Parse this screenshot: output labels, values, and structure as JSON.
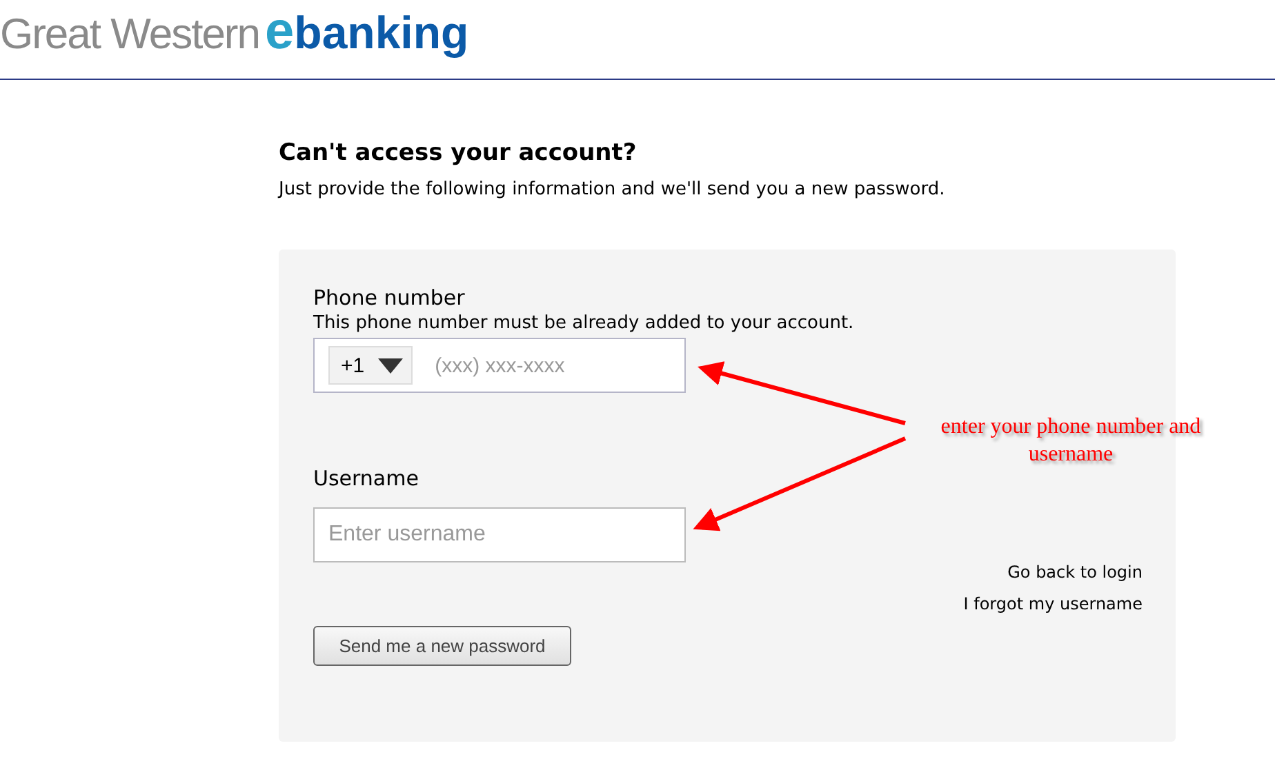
{
  "logo": {
    "brand": "Great Western",
    "mark": "e",
    "product": "banking"
  },
  "heading": "Can't access your account?",
  "intro": "Just provide the following information and we'll send you a new password.",
  "phone": {
    "label": "Phone number",
    "hint": "This phone number must be already added to your account.",
    "country_code": "+1",
    "placeholder": "(xxx) xxx-xxxx"
  },
  "username": {
    "label": "Username",
    "placeholder": "Enter username"
  },
  "links": [
    "Go back to login",
    "I forgot my username"
  ],
  "submit": "Send me a new password",
  "annotation": "enter your phone number and username"
}
